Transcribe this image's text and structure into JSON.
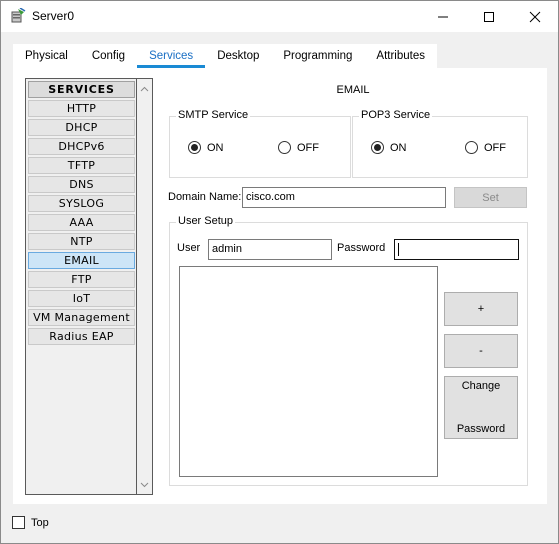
{
  "window": {
    "title": "Server0",
    "minimize_icon": "minimize-icon",
    "maximize_icon": "maximize-icon",
    "close_icon": "close-icon"
  },
  "tabs": [
    {
      "label": "Physical",
      "active": false
    },
    {
      "label": "Config",
      "active": false
    },
    {
      "label": "Services",
      "active": true
    },
    {
      "label": "Desktop",
      "active": false
    },
    {
      "label": "Programming",
      "active": false
    },
    {
      "label": "Attributes",
      "active": false
    }
  ],
  "sidebar": {
    "header": "SERVICES",
    "items": [
      {
        "label": "HTTP",
        "selected": false
      },
      {
        "label": "DHCP",
        "selected": false
      },
      {
        "label": "DHCPv6",
        "selected": false
      },
      {
        "label": "TFTP",
        "selected": false
      },
      {
        "label": "DNS",
        "selected": false
      },
      {
        "label": "SYSLOG",
        "selected": false
      },
      {
        "label": "AAA",
        "selected": false
      },
      {
        "label": "NTP",
        "selected": false
      },
      {
        "label": "EMAIL",
        "selected": true
      },
      {
        "label": "FTP",
        "selected": false
      },
      {
        "label": "IoT",
        "selected": false
      },
      {
        "label": "VM Management",
        "selected": false
      },
      {
        "label": "Radius EAP",
        "selected": false
      }
    ]
  },
  "email": {
    "title": "EMAIL",
    "smtp": {
      "legend": "SMTP Service",
      "on_label": "ON",
      "off_label": "OFF",
      "selected": "ON"
    },
    "pop3": {
      "legend": "POP3 Service",
      "on_label": "ON",
      "off_label": "OFF",
      "selected": "ON"
    },
    "domain": {
      "label": "Domain Name:",
      "value": "cisco.com",
      "set_label": "Set"
    },
    "user_setup": {
      "legend": "User Setup",
      "user_label": "User",
      "user_value": "admin",
      "password_label": "Password",
      "password_value": "",
      "add_label": "+",
      "remove_label": "-",
      "change_label_line1": "Change",
      "change_label_line2": "Password",
      "users": []
    }
  },
  "footer": {
    "top_label": "Top",
    "top_checked": false
  }
}
